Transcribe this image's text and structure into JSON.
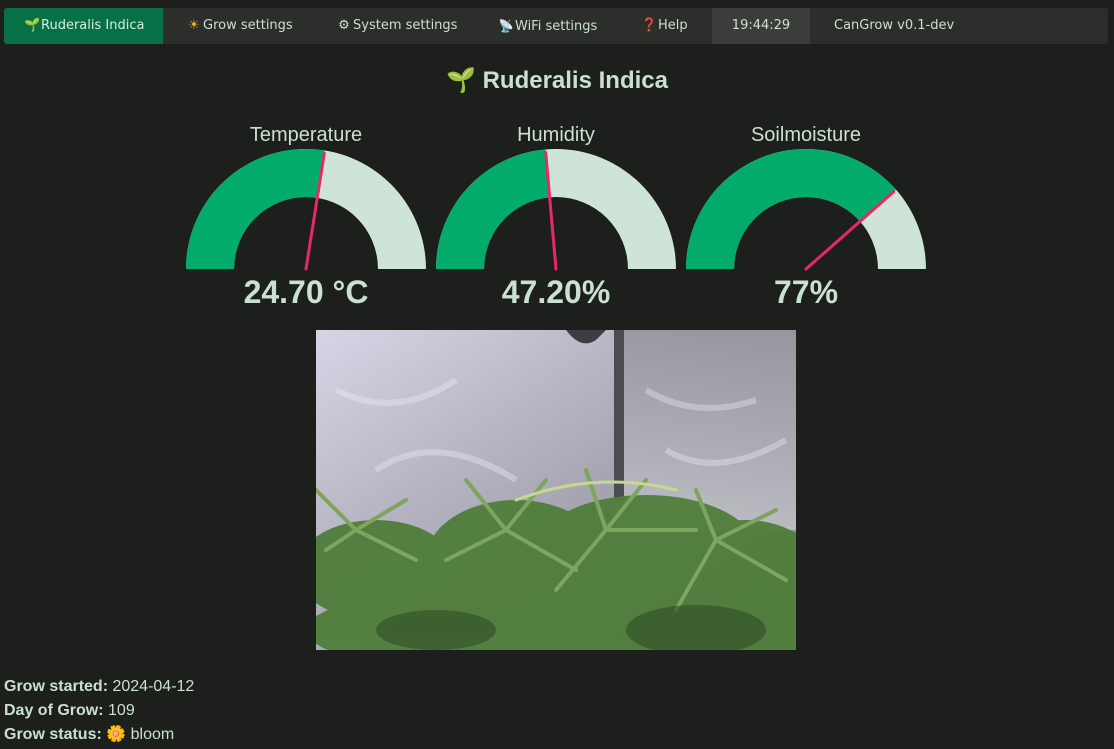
{
  "nav": {
    "grow_tab": {
      "icon": "sprout-icon",
      "label": "Ruderalis Indica"
    },
    "grow_settings": {
      "icon": "sun-icon",
      "label": "Grow settings"
    },
    "system_settings": {
      "icon": "gear-icon",
      "label": "System settings"
    },
    "wifi_settings": {
      "icon": "satellite-icon",
      "label": "WiFi settings"
    },
    "help": {
      "icon": "question-icon",
      "label": "Help"
    },
    "clock": "19:44:29",
    "version": "CanGrow v0.1-dev"
  },
  "page": {
    "title_icon": "sprout-icon",
    "title": "Ruderalis Indica"
  },
  "gauges": [
    {
      "label": "Temperature",
      "value_text": "24.70 °C",
      "fraction": 0.55
    },
    {
      "label": "Humidity",
      "value_text": "47.20%",
      "fraction": 0.472
    },
    {
      "label": "Soilmoisture",
      "value_text": "77%",
      "fraction": 0.77
    }
  ],
  "colors": {
    "accent": "#087046",
    "gauge_fill": "#04ac6c",
    "gauge_track": "#cde4d6",
    "needle": "#e8286a",
    "background": "#1c1f1c",
    "text": "#cae0d0"
  },
  "camera": {
    "alt": "Grow camera image"
  },
  "info": {
    "started_label": "Grow started:",
    "started_value": "2024-04-12",
    "day_label": "Day of Grow:",
    "day_value": "109",
    "status_label": "Grow status:",
    "status_icon": "flower-icon",
    "status_value": "bloom"
  }
}
